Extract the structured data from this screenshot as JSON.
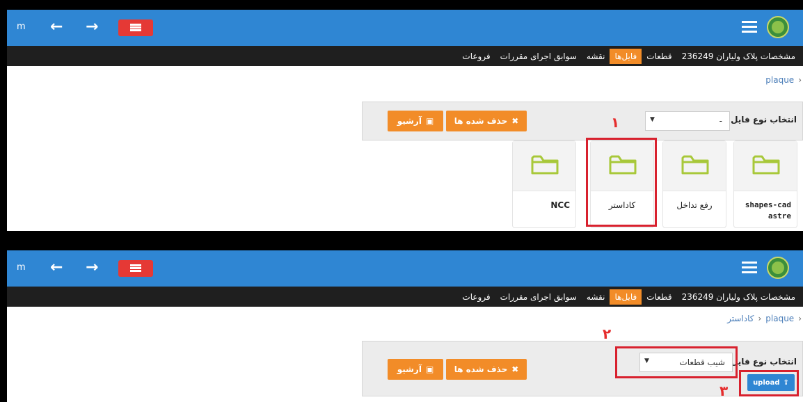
{
  "topbar": {
    "user_initial": "m",
    "back_icon": "arrow-left-icon",
    "forward_icon": "arrow-right-icon",
    "menu_icon": "menu-icon",
    "hamburger_icon": "hamburger-icon",
    "logo_icon": "organization-logo-icon",
    "color": "#2f86d3"
  },
  "tabs": [
    {
      "label": "مشخصات پلاک ولیاران 236249",
      "active": false
    },
    {
      "label": "قطعات",
      "active": false
    },
    {
      "label": "فایل‌ها",
      "active": true
    },
    {
      "label": "نقشه",
      "active": false
    },
    {
      "label": "سوابق اجرای مقررات",
      "active": false
    },
    {
      "label": "فروعات",
      "active": false
    }
  ],
  "panel1": {
    "breadcrumb": [
      {
        "label": "plaque"
      }
    ],
    "filter_label": "انتخاب نوع فایل",
    "select_value": "-",
    "deleted_button": "حذف شده ها",
    "archive_button": "آرشیو",
    "marker": "۱",
    "folders": [
      {
        "name": "shapes-cadastre",
        "icon": "folder-icon"
      },
      {
        "name": "رفع تداخل",
        "icon": "folder-icon"
      },
      {
        "name": "کاداستر",
        "icon": "folder-icon"
      },
      {
        "name": "NCC",
        "icon": "folder-icon"
      }
    ]
  },
  "panel2": {
    "breadcrumb": [
      {
        "label": "plaque"
      },
      {
        "label": "کاداستر"
      }
    ],
    "filter_label": "انتخاب نوع فایل",
    "select_value": "شیب قطعات",
    "deleted_button": "حذف شده ها",
    "archive_button": "آرشیو",
    "upload_button": "upload",
    "marker_select": "۲",
    "marker_upload": "۳"
  },
  "colors": {
    "accent": "#f28c28",
    "highlight": "#d8212e",
    "folder": "#a8c83a"
  }
}
